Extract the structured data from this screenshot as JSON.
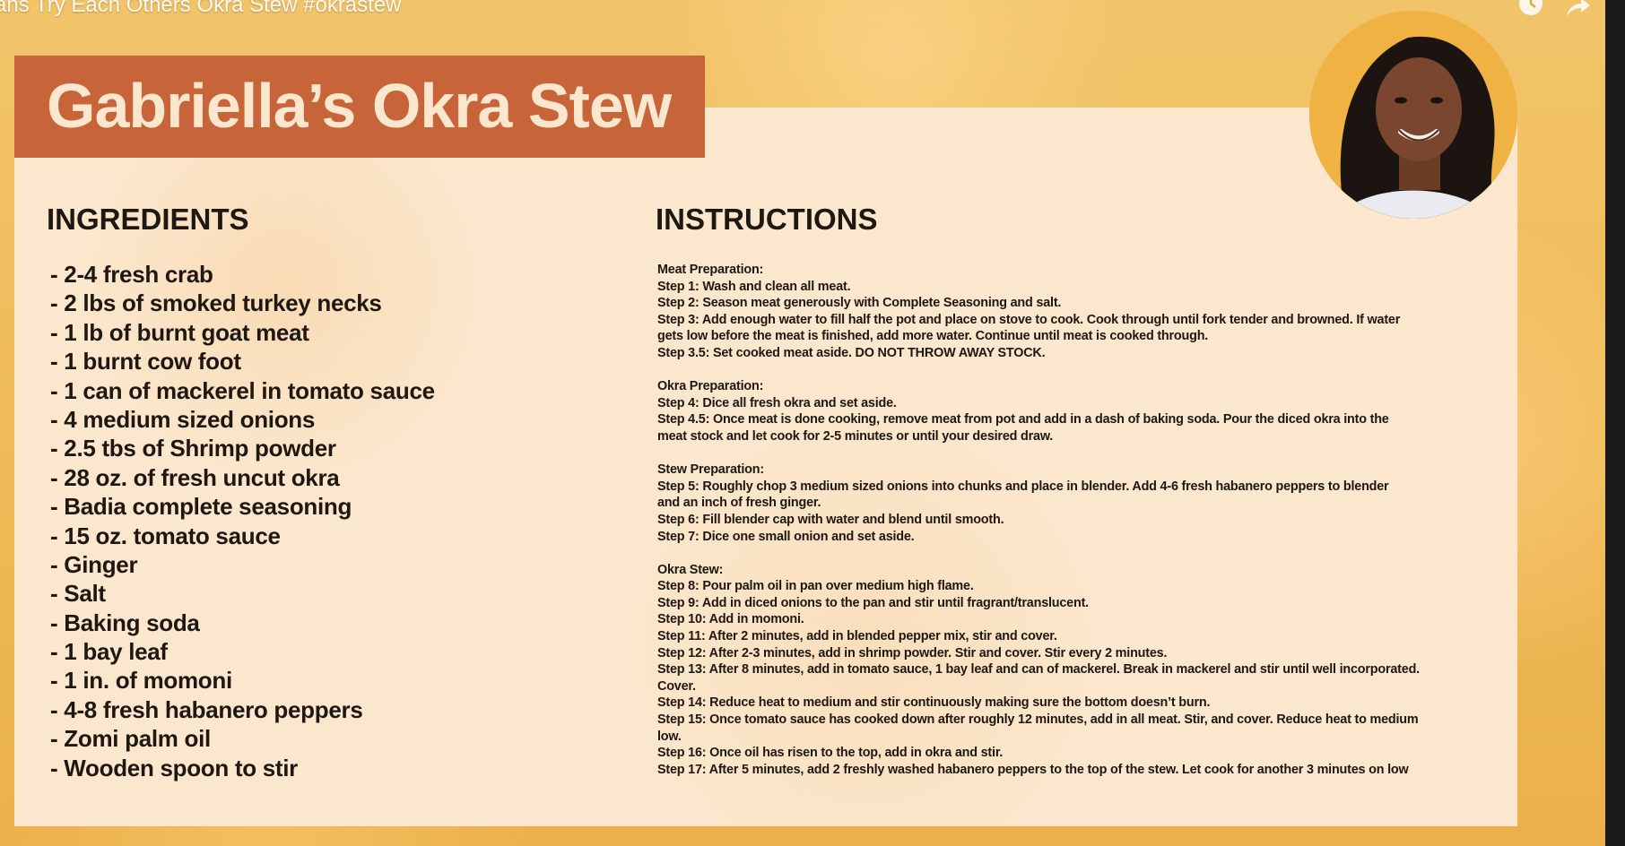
{
  "video": {
    "title": "ans Try Each Others Okra Stew #okrastew"
  },
  "card": {
    "title": "Gabriella’s Okra Stew",
    "ingredients_heading": "INGREDIENTS",
    "instructions_heading": "INSTRUCTIONS",
    "ingredients": [
      "- 2-4 fresh crab",
      "- 2 lbs of smoked turkey necks",
      "- 1 lb of burnt goat meat",
      "- 1 burnt cow foot",
      "- 1 can of mackerel in tomato sauce",
      "- 4 medium sized onions",
      "- 2.5 tbs of Shrimp powder",
      "- 28 oz. of fresh uncut okra",
      "- Badia complete seasoning",
      "- 15 oz. tomato sauce",
      "- Ginger",
      "- Salt",
      "- Baking soda",
      "- 1 bay leaf",
      "- 1 in. of momoni",
      "- 4-8 fresh habanero peppers",
      "- Zomi palm oil",
      "- Wooden spoon to stir"
    ],
    "instructions": [
      {
        "heading": "Meat Preparation:",
        "lines": [
          "Step 1: Wash and clean all meat.",
          "Step 2: Season meat generously with Complete Seasoning and salt.",
          "Step 3: Add enough water to fill half the pot and place on stove to cook. Cook through until fork tender and browned. If water",
          "gets low before the meat is finished, add more water. Continue until meat is cooked through.",
          "Step 3.5: Set cooked meat aside. DO NOT THROW AWAY STOCK."
        ]
      },
      {
        "heading": "Okra Preparation:",
        "lines": [
          "Step 4: Dice all fresh okra and set aside.",
          "Step 4.5: Once meat is done cooking, remove meat from pot and add in a dash of baking soda. Pour the diced okra into the",
          "meat stock and let cook for 2-5 minutes or until your desired draw."
        ]
      },
      {
        "heading": "Stew Preparation:",
        "lines": [
          "Step 5: Roughly chop 3 medium sized onions into chunks and place in blender. Add 4-6 fresh habanero peppers to blender",
          "and an inch of fresh ginger.",
          "Step 6: Fill blender cap with water and blend until smooth.",
          "Step 7: Dice one small onion and set aside."
        ]
      },
      {
        "heading": "Okra Stew:",
        "lines": [
          "Step 8: Pour palm oil in pan over medium high flame.",
          "Step 9: Add in diced onions to the pan and stir until fragrant/translucent.",
          "Step 10: Add in momoni.",
          "Step 11: After 2 minutes, add in blended pepper mix, stir and cover.",
          "Step 12: After 2-3 minutes, add in shrimp powder. Stir and cover. Stir every 2 minutes.",
          "Step 13: After 8 minutes, add in tomato sauce, 1 bay leaf and can of mackerel. Break in mackerel and stir until well incorporated.",
          "Cover.",
          "Step 14: Reduce heat to medium and stir continuously making sure the bottom doesn’t burn.",
          "Step 15: Once tomato sauce has cooked down after roughly 12 minutes, add in all meat. Stir, and cover. Reduce heat to medium",
          "low.",
          "Step 16: Once oil has risen to the top, add in okra and stir.",
          "Step 17: After 5 minutes, add 2 freshly washed habanero peppers to the top of the stew. Let cook for another 3 minutes on low"
        ]
      }
    ]
  },
  "overlay": {
    "icons": [
      "clock-icon",
      "share-icon"
    ]
  }
}
